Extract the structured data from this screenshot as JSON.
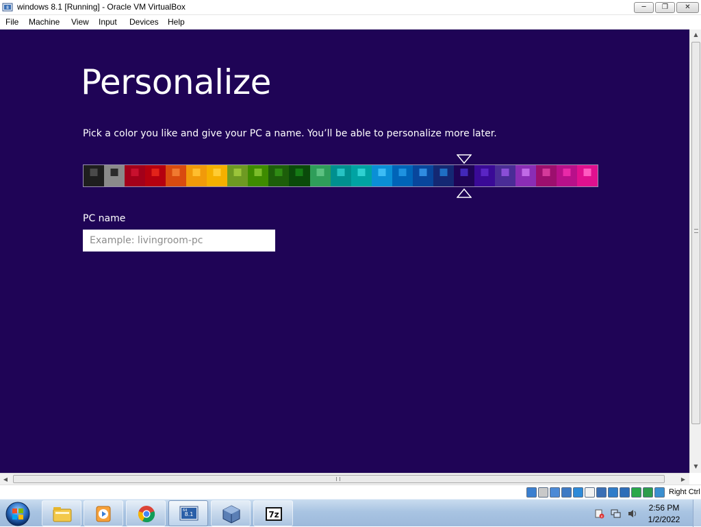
{
  "window": {
    "title": "windows 8.1 [Running] - Oracle VM VirtualBox",
    "minimize_icon": "minimize-icon",
    "maximize_icon": "restore-icon",
    "close_icon": "close-icon"
  },
  "menubar": {
    "items": [
      {
        "label": "File"
      },
      {
        "label": "Machine"
      },
      {
        "label": "View"
      },
      {
        "label": "Input"
      },
      {
        "label": "Devices"
      },
      {
        "label": "Help"
      }
    ]
  },
  "setup": {
    "headline": "Personalize",
    "subtitle": "Pick a color you like and give your PC a name. You’ll be able to personalize more later.",
    "pc_name_label": "PC name",
    "pc_name_value": "",
    "pc_name_placeholder": "Example: livingroom-pc",
    "selected_color_index": 18,
    "colors": [
      {
        "bg": "#1e1e1e",
        "chip": "#4a4a4a"
      },
      {
        "bg": "#8a8a8a",
        "chip": "#2b2b2b"
      },
      {
        "bg": "#a3001a",
        "chip": "#c8102e"
      },
      {
        "bg": "#b5000f",
        "chip": "#e2231a"
      },
      {
        "bg": "#d94b0f",
        "chip": "#f07a30"
      },
      {
        "bg": "#f19a0a",
        "chip": "#ffbe2e"
      },
      {
        "bg": "#f5b000",
        "chip": "#ffcc33"
      },
      {
        "bg": "#6e9a22",
        "chip": "#9bc43a"
      },
      {
        "bg": "#3e8c00",
        "chip": "#7bbd2a"
      },
      {
        "bg": "#1d5e0a",
        "chip": "#2f8a14"
      },
      {
        "bg": "#0a4a0a",
        "chip": "#157a15"
      },
      {
        "bg": "#2f9e5a",
        "chip": "#5cc181"
      },
      {
        "bg": "#00908f",
        "chip": "#27c3c3"
      },
      {
        "bg": "#00a3a3",
        "chip": "#2fd1d1"
      },
      {
        "bg": "#0a8fd6",
        "chip": "#3cbcf5"
      },
      {
        "bg": "#0064b8",
        "chip": "#1e92e0"
      },
      {
        "bg": "#08469c",
        "chip": "#2f8be0"
      },
      {
        "bg": "#142873",
        "chip": "#1f6fc4"
      },
      {
        "bg": "#1f0456",
        "chip": "#4228b8"
      },
      {
        "bg": "#3a0a96",
        "chip": "#5a25c4"
      },
      {
        "bg": "#4a2c96",
        "chip": "#8a4ed6"
      },
      {
        "bg": "#8a2db5",
        "chip": "#c06ae6"
      },
      {
        "bg": "#9c0f6e",
        "chip": "#d43a9a"
      },
      {
        "bg": "#b8108a",
        "chip": "#e82aa8"
      },
      {
        "bg": "#e0108f",
        "chip": "#ff5ac0"
      }
    ]
  },
  "statusbar": {
    "host_key": "Right Ctrl",
    "icons": [
      "hard-disk-icon",
      "optical-drive-icon",
      "audio-icon",
      "network-icon",
      "usb-icon",
      "shared-folders-icon",
      "display-icon",
      "video-capture-icon",
      "screen-icon",
      "vt-x-icon",
      "mouse-integration-icon",
      "keyboard-icon"
    ]
  },
  "taskbar": {
    "start_icon": "windows-start-orb-icon",
    "apps": [
      {
        "name": "file-explorer-icon"
      },
      {
        "name": "media-player-icon"
      },
      {
        "name": "chrome-icon"
      },
      {
        "name": "windows-8.1-vm-icon",
        "badge": "8.1",
        "badge_top": "64"
      },
      {
        "name": "virtualbox-icon"
      },
      {
        "name": "7zip-icon",
        "label": "7z"
      }
    ],
    "tray_icons": [
      "action-center-icon",
      "network-icon",
      "volume-icon"
    ],
    "clock_time": "2:56 PM",
    "clock_date": "1/2/2022"
  }
}
